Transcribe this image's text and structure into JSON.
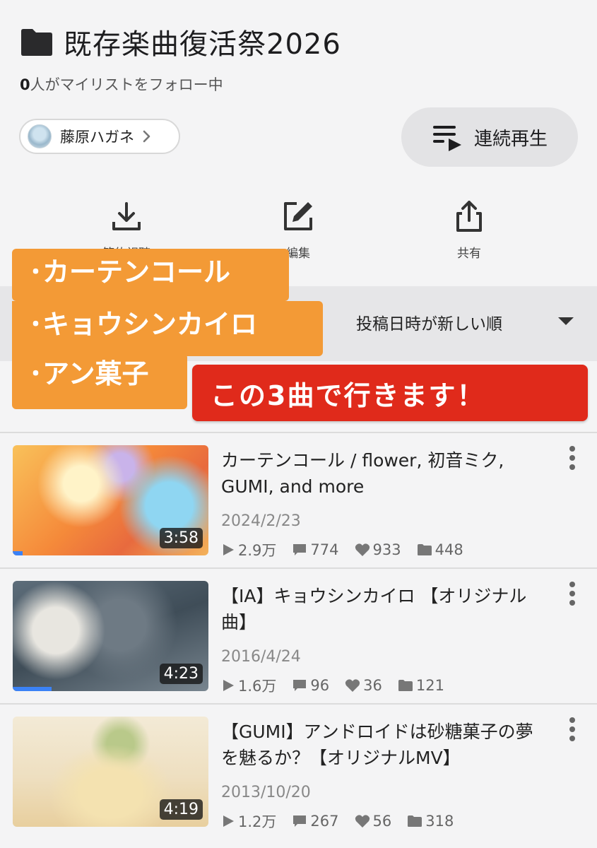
{
  "header": {
    "title": "既存楽曲復活祭2026",
    "follow_count": "0",
    "follow_text": "人がマイリストをフォロー中",
    "owner_name": "藤原ハガネ",
    "play_all_label": "連続再生"
  },
  "actions": [
    {
      "label": "節約視聴",
      "icon": "download-icon"
    },
    {
      "label": "編集",
      "icon": "edit-icon"
    },
    {
      "label": "共有",
      "icon": "share-icon"
    }
  ],
  "sort": {
    "label": "投稿日時が新しい順"
  },
  "overlay": {
    "line1": "･カーテンコール",
    "line2": "･キョウシンカイロ",
    "line3": "･アン菓子",
    "banner": "この3曲で行きます！"
  },
  "videos": [
    {
      "title": "カーテンコール / flower, 初音ミク, GUMI, and more",
      "date": "2024/2/23",
      "duration": "3:58",
      "views": "2.9万",
      "comments": "774",
      "likes": "933",
      "mylists": "448",
      "watched_progress": 0.05
    },
    {
      "title": "【IA】キョウシンカイロ 【オリジナル曲】",
      "date": "2016/4/24",
      "duration": "4:23",
      "views": "1.6万",
      "comments": "96",
      "likes": "36",
      "mylists": "121",
      "watched_progress": 0.2
    },
    {
      "title": "【GUMI】アンドロイドは砂糖菓子の夢を魅るか？【オリジナルMV】",
      "date": "2013/10/20",
      "duration": "4:19",
      "views": "1.2万",
      "comments": "267",
      "likes": "56",
      "mylists": "318",
      "watched_progress": 0
    }
  ],
  "colors": {
    "overlay_orange": "#f39a36",
    "banner_red": "#e02a1b",
    "progress_blue": "#3b82f6"
  }
}
